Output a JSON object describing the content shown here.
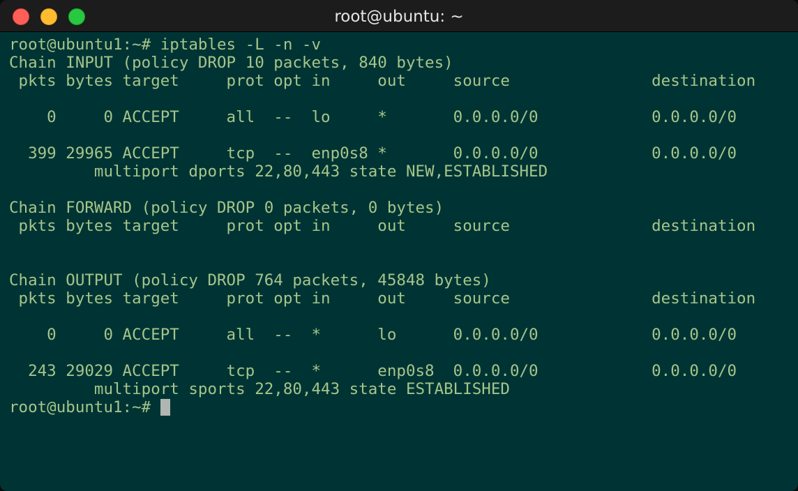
{
  "window": {
    "title": "root@ubuntu: ~"
  },
  "terminal": {
    "lines": [
      "root@ubuntu1:~# iptables -L -n -v",
      "Chain INPUT (policy DROP 10 packets, 840 bytes)",
      " pkts bytes target     prot opt in     out     source               destination",
      "",
      "    0     0 ACCEPT     all  --  lo     *       0.0.0.0/0            0.0.0.0/0",
      "",
      "  399 29965 ACCEPT     tcp  --  enp0s8 *       0.0.0.0/0            0.0.0.0/0",
      "         multiport dports 22,80,443 state NEW,ESTABLISHED",
      "",
      "Chain FORWARD (policy DROP 0 packets, 0 bytes)",
      " pkts bytes target     prot opt in     out     source               destination",
      "",
      "",
      "Chain OUTPUT (policy DROP 764 packets, 45848 bytes)",
      " pkts bytes target     prot opt in     out     source               destination",
      "",
      "    0     0 ACCEPT     all  --  *      lo      0.0.0.0/0            0.0.0.0/0",
      "",
      "  243 29029 ACCEPT     tcp  --  *      enp0s8  0.0.0.0/0            0.0.0.0/0",
      "         multiport sports 22,80,443 state ESTABLISHED"
    ],
    "prompt": "root@ubuntu1:~#"
  },
  "colors": {
    "background": "#003434",
    "text": "#a5c58a",
    "titlebar": "#1c1c1c",
    "cursor": "#b0b7b3"
  },
  "icons": {
    "close": "close-icon",
    "minimize": "minimize-icon",
    "zoom": "zoom-icon"
  }
}
